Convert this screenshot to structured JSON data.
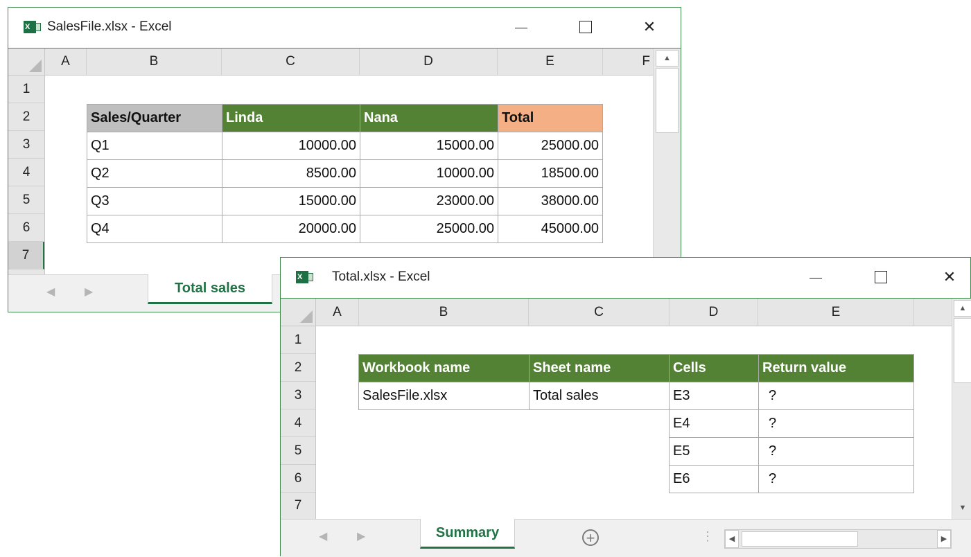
{
  "window1": {
    "title": "SalesFile.xlsx - Excel",
    "logo": "X",
    "controls": {
      "minimize": "—",
      "maximize": "☐",
      "close": "✕"
    },
    "columns": [
      "A",
      "B",
      "C",
      "D",
      "E",
      "F"
    ],
    "rows": [
      "1",
      "2",
      "3",
      "4",
      "5",
      "6",
      "7"
    ],
    "table": {
      "headers": [
        "Sales/Quarter",
        "Linda",
        "Nana",
        "Total"
      ],
      "rows": [
        [
          "Q1",
          "10000.00",
          "15000.00",
          "25000.00"
        ],
        [
          "Q2",
          "8500.00",
          "10000.00",
          "18500.00"
        ],
        [
          "Q3",
          "15000.00",
          "23000.00",
          "38000.00"
        ],
        [
          "Q4",
          "20000.00",
          "25000.00",
          "45000.00"
        ]
      ]
    },
    "sheet_tab": "Total sales",
    "colors": {
      "header_gray": "#bfbfbf",
      "header_green": "#548235",
      "header_orange": "#f4b084",
      "accent": "#217346"
    }
  },
  "window2": {
    "title": "Total.xlsx - Excel",
    "logo": "X",
    "controls": {
      "minimize": "—",
      "maximize": "☐",
      "close": "✕"
    },
    "columns": [
      "A",
      "B",
      "C",
      "D",
      "E"
    ],
    "rows": [
      "1",
      "2",
      "3",
      "4",
      "5",
      "6",
      "7"
    ],
    "table": {
      "headers": [
        "Workbook name",
        "Sheet name",
        "Cells",
        "Return value"
      ],
      "first_row": {
        "workbook": "SalesFile.xlsx",
        "sheet": "Total sales"
      },
      "cells": [
        "E3",
        "E4",
        "E5",
        "E6"
      ],
      "return_values": [
        "?",
        "?",
        "?",
        "?"
      ]
    },
    "sheet_tab": "Summary",
    "add_sheet": "+"
  }
}
